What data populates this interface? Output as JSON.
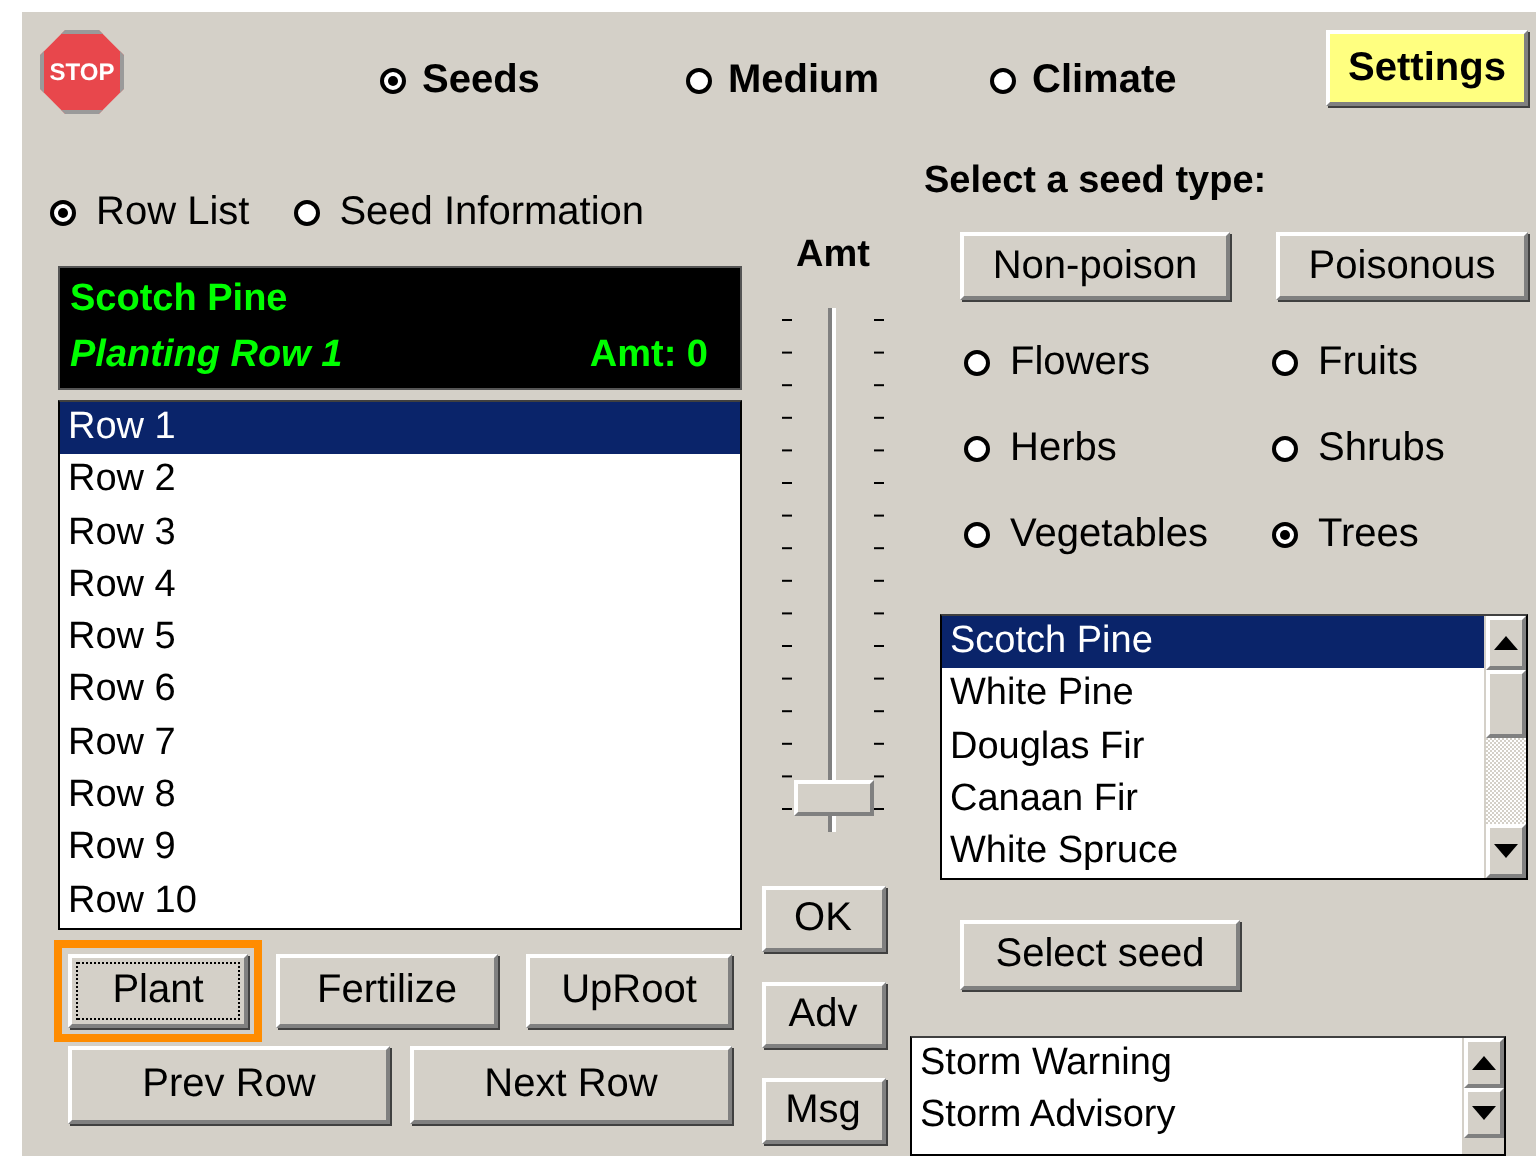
{
  "stop_button": "STOP",
  "top_tabs": [
    {
      "label": "Seeds",
      "selected": true
    },
    {
      "label": "Medium",
      "selected": false
    },
    {
      "label": "Climate",
      "selected": false
    }
  ],
  "settings_button": "Settings",
  "view_options": [
    {
      "label": "Row List",
      "selected": true
    },
    {
      "label": "Seed Information",
      "selected": false
    }
  ],
  "display": {
    "seed": "Scotch Pine",
    "status": "Planting Row 1",
    "amount": "Amt: 0"
  },
  "rows": [
    {
      "label": "Row 1",
      "selected": true
    },
    {
      "label": "Row 2",
      "selected": false
    },
    {
      "label": "Row 3",
      "selected": false
    },
    {
      "label": "Row 4",
      "selected": false
    },
    {
      "label": "Row 5",
      "selected": false
    },
    {
      "label": "Row 6",
      "selected": false
    },
    {
      "label": "Row 7",
      "selected": false
    },
    {
      "label": "Row 8",
      "selected": false
    },
    {
      "label": "Row 9",
      "selected": false
    },
    {
      "label": "Row 10",
      "selected": false
    }
  ],
  "row_actions": [
    {
      "label": "Plant",
      "focused": true
    },
    {
      "label": "Fertilize",
      "focused": false
    },
    {
      "label": "UpRoot",
      "focused": false
    }
  ],
  "nav_buttons": [
    "Prev Row",
    "Next Row"
  ],
  "amount_slider": {
    "label": "Amt",
    "level": 0
  },
  "side_buttons": [
    "OK",
    "Adv",
    "Msg"
  ],
  "seed_type_heading": "Select a seed type:",
  "toxicity_buttons": [
    "Non-poison",
    "Poisonous"
  ],
  "categories": [
    {
      "label": "Flowers",
      "selected": false
    },
    {
      "label": "Fruits",
      "selected": false
    },
    {
      "label": "Herbs",
      "selected": false
    },
    {
      "label": "Shrubs",
      "selected": false
    },
    {
      "label": "Vegetables",
      "selected": false
    },
    {
      "label": "Trees",
      "selected": true
    }
  ],
  "seeds": [
    {
      "label": "Scotch Pine",
      "selected": true
    },
    {
      "label": "White Pine",
      "selected": false
    },
    {
      "label": "Douglas Fir",
      "selected": false
    },
    {
      "label": "Canaan Fir",
      "selected": false
    },
    {
      "label": "White Spruce",
      "selected": false
    }
  ],
  "select_seed_button": "Select seed",
  "messages": [
    "Storm Warning",
    "Storm Advisory"
  ]
}
